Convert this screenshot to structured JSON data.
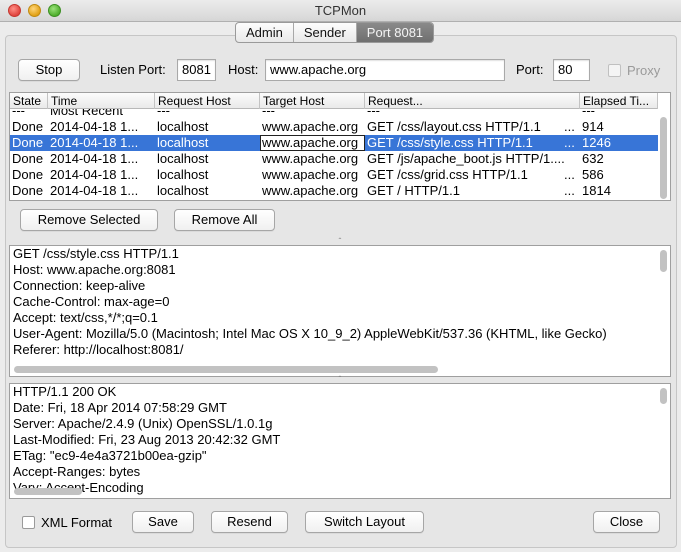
{
  "window": {
    "title": "TCPMon"
  },
  "tabs": [
    {
      "label": "Admin"
    },
    {
      "label": "Sender"
    },
    {
      "label": "Port 8081"
    }
  ],
  "toolbar": {
    "stop_label": "Stop",
    "listen_port_label": "Listen Port:",
    "listen_port_value": "8081",
    "host_label": "Host:",
    "host_value": "www.apache.org",
    "port_label": "Port:",
    "port_value": "80",
    "proxy_label": "Proxy"
  },
  "table": {
    "columns": [
      "State",
      "Time",
      "Request Host",
      "Target Host",
      "Request...",
      "Elapsed Ti..."
    ],
    "partial_row": [
      "---",
      "Most Recent",
      "---",
      "---",
      "---",
      "---"
    ],
    "rows": [
      {
        "state": "Done",
        "time": "2014-04-18 1...",
        "req_host": "localhost",
        "target_host": "www.apache.org",
        "request": "GET /css/layout.css HTTP/1.1",
        "ellipsis": "...",
        "elapsed": "914"
      },
      {
        "state": "Done",
        "time": "2014-04-18 1...",
        "req_host": "localhost",
        "target_host": "www.apache.org",
        "request": "GET /css/style.css HTTP/1.1",
        "ellipsis": "...",
        "elapsed": "1246"
      },
      {
        "state": "Done",
        "time": "2014-04-18 1...",
        "req_host": "localhost",
        "target_host": "www.apache.org",
        "request": "GET /js/apache_boot.js HTTP/1....",
        "ellipsis": "",
        "elapsed": "632"
      },
      {
        "state": "Done",
        "time": "2014-04-18 1...",
        "req_host": "localhost",
        "target_host": "www.apache.org",
        "request": "GET /css/grid.css HTTP/1.1",
        "ellipsis": "...",
        "elapsed": "586"
      },
      {
        "state": "Done",
        "time": "2014-04-18 1...",
        "req_host": "localhost",
        "target_host": "www.apache.org",
        "request": "GET / HTTP/1.1",
        "ellipsis": "...",
        "elapsed": "1814"
      }
    ]
  },
  "list_actions": {
    "remove_selected_label": "Remove Selected",
    "remove_all_label": "Remove All"
  },
  "request_text": [
    "GET /css/style.css HTTP/1.1",
    "Host: www.apache.org:8081",
    "Connection: keep-alive",
    "Cache-Control: max-age=0",
    "Accept: text/css,*/*;q=0.1",
    "User-Agent: Mozilla/5.0 (Macintosh; Intel Mac OS X 10_9_2) AppleWebKit/537.36 (KHTML, like Gecko)",
    "Referer: http://localhost:8081/"
  ],
  "response_text": [
    "HTTP/1.1 200 OK",
    "Date: Fri, 18 Apr 2014 07:58:29 GMT",
    "Server: Apache/2.4.9 (Unix) OpenSSL/1.0.1g",
    "Last-Modified: Fri, 23 Aug 2013 20:42:32 GMT",
    "ETag: \"ec9-4e4a3721b00ea-gzip\"",
    "Accept-Ranges: bytes",
    "Vary: Accept-Encoding"
  ],
  "bottom_bar": {
    "xml_format_label": "XML Format",
    "save_label": "Save",
    "resend_label": "Resend",
    "switch_layout_label": "Switch Layout",
    "close_label": "Close"
  },
  "colors": {
    "selection": "#3875d7",
    "active_tab": "#7a7a7a"
  }
}
